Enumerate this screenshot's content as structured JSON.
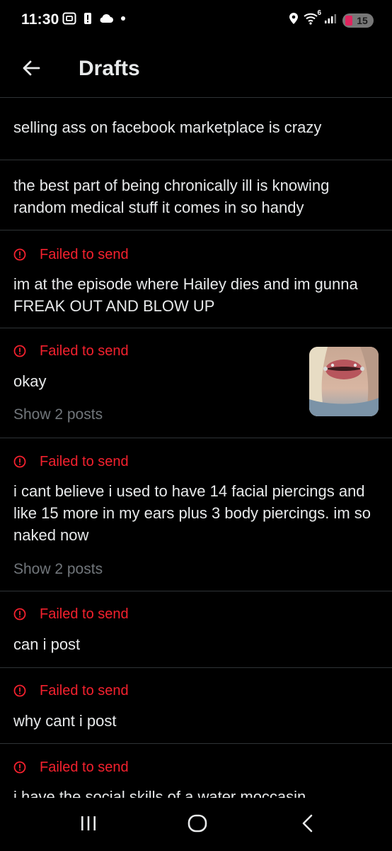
{
  "status_bar": {
    "time": "11:30",
    "wifi_label": "6",
    "battery": "15",
    "left_icons": [
      "screenshot-icon",
      "alert-icon",
      "cloud-icon",
      "dot-icon"
    ],
    "right_icons": [
      "location-icon",
      "wifi-icon",
      "signal-icon",
      "battery-icon"
    ]
  },
  "header": {
    "title": "Drafts",
    "back_icon": "arrow-left-icon"
  },
  "colors": {
    "background": "#000000",
    "text": "#e7e9ea",
    "error": "#f4212e",
    "muted": "#71767b",
    "divider": "#2f3336"
  },
  "drafts": [
    {
      "failed": false,
      "text": "selling ass on facebook marketplace is crazy"
    },
    {
      "failed": false,
      "text": "the best part of being chronically ill is knowing random medical stuff it comes in so handy"
    },
    {
      "failed": true,
      "status": "Failed to send",
      "text": "im at the episode where Hailey dies and im gunna FREAK OUT AND BLOW UP"
    },
    {
      "failed": true,
      "status": "Failed to send",
      "text": "okay",
      "show_posts": "Show 2 posts",
      "has_thumbnail": true
    },
    {
      "failed": true,
      "status": "Failed to send",
      "text": "i cant believe i used to have 14 facial piercings and like 15 more in my ears plus 3 body piercings. im so naked now",
      "show_posts": "Show 2 posts"
    },
    {
      "failed": true,
      "status": "Failed to send",
      "text": "can i post"
    },
    {
      "failed": true,
      "status": "Failed to send",
      "text": "why cant i post"
    },
    {
      "failed": true,
      "status": "Failed to send",
      "text": "i have the social skills of a water moccasin"
    }
  ],
  "nav_bar": {
    "items": [
      "recents-icon",
      "home-icon",
      "back-icon"
    ]
  }
}
